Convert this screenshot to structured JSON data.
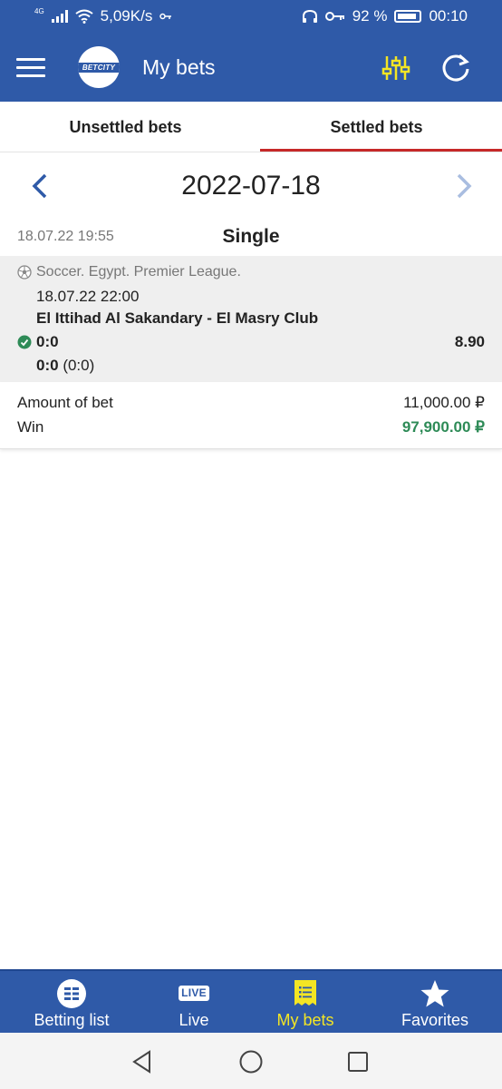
{
  "status_bar": {
    "network_type": "4G",
    "speed": "5,09K/s",
    "battery_percent": "92 %",
    "time": "00:10"
  },
  "app_bar": {
    "logo_text": "BETCITY",
    "title": "My bets"
  },
  "tabs": [
    {
      "label": "Unsettled bets",
      "active": false
    },
    {
      "label": "Settled bets",
      "active": true
    }
  ],
  "date_nav": {
    "date": "2022-07-18"
  },
  "bet": {
    "time": "18.07.22 19:55",
    "type": "Single",
    "event": {
      "league": "Soccer. Egypt. Premier League.",
      "date": "18.07.22 22:00",
      "match": "El Ittihad Al Sakandary - El Masry Club",
      "outcome": "0:0",
      "odds": "8.90",
      "result_score": "0:0",
      "result_half": "(0:0)"
    },
    "summary": {
      "amount_label": "Amount of bet",
      "amount_value": "11,000.00 ₽",
      "win_label": "Win",
      "win_value": "97,900.00 ₽"
    }
  },
  "bottom_nav": [
    {
      "label": "Betting list",
      "icon": "list-circle-icon",
      "active": false
    },
    {
      "label": "Live",
      "icon": "live-badge-icon",
      "badge": "LIVE",
      "active": false
    },
    {
      "label": "My bets",
      "icon": "receipt-icon",
      "active": true
    },
    {
      "label": "Favorites",
      "icon": "star-icon",
      "active": false
    }
  ],
  "colors": {
    "primary": "#2f5aa8",
    "active_tab_underline": "#c62828",
    "win": "#2e8b57",
    "accent_yellow": "#f3e524"
  }
}
